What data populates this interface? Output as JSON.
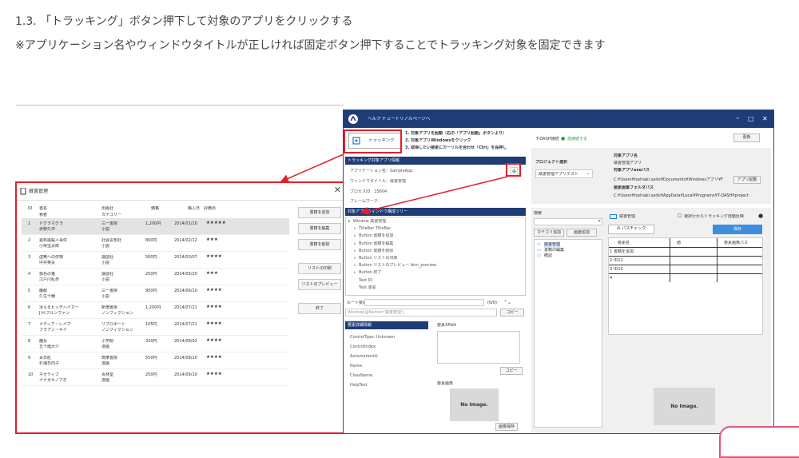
{
  "doc": {
    "heading": "1.3. 「トラッキング」ボタン押下して対象のアプリをクリックする",
    "note": "※アプリケーション名やウィンドウタイトルが正しければ固定ボタン押下することでトラッキング対象を固定できます"
  },
  "left_dialog": {
    "title": "蔵書管理",
    "columns": {
      "id": "ID",
      "title1": "書名",
      "title2": "著者",
      "pub1": "出版社",
      "pub2": "カテゴリー",
      "price": "価格",
      "date": "購入日",
      "rating": "評価点"
    },
    "rows": [
      {
        "id": "1",
        "title": "ドグラマグラ",
        "author": "夢野久作",
        "pub": "三一書房",
        "cat": "小説",
        "price": "1,200円",
        "date": "2014/01/10",
        "stars": "★★★★★"
      },
      {
        "id": "2",
        "title": "異邦風殺人事件",
        "author": "小栗虫太郎",
        "pub": "社会思想社",
        "cat": "小説",
        "price": "800円",
        "date": "2014/02/12",
        "stars": "★★★"
      },
      {
        "id": "3",
        "title": "虚無への供物",
        "author": "中井英夫",
        "pub": "講談社",
        "cat": "小説",
        "price": "500円",
        "date": "2014/03/07",
        "stars": "★★★★"
      },
      {
        "id": "4",
        "title": "孤島の鬼",
        "author": "江戸川乱歩",
        "pub": "講談社",
        "cat": "小説",
        "price": "250円",
        "date": "2014/05/20",
        "stars": "★★★"
      },
      {
        "id": "5",
        "title": "魔都",
        "author": "久生十蘭",
        "pub": "三一書房",
        "cat": "小説",
        "price": "950円",
        "date": "2014/06/10",
        "stars": "★★★★"
      },
      {
        "id": "6",
        "title": "冰えるヒッチハイカー",
        "author": "J.H.ブルンヴァン",
        "pub": "新宿書房",
        "cat": "ノンフィクション",
        "price": "1,200円",
        "date": "2014/07/21",
        "stars": "★★★★"
      },
      {
        "id": "7",
        "title": "メディア・レイプ",
        "author": "ブラアン・キイ",
        "pub": "リブロポート",
        "cat": "ノンフィクション",
        "price": "105円",
        "date": "2014/07/21",
        "stars": "★★★★"
      },
      {
        "id": "8",
        "title": "魔女",
        "author": "五十嵐大介",
        "pub": "小学館",
        "cat": "漫画",
        "price": "330円",
        "date": "2014/08/02",
        "stars": "★★★★"
      },
      {
        "id": "9",
        "title": "百日紅",
        "author": "杉浦日向子",
        "pub": "筑摩書房",
        "cat": "漫画",
        "price": "550円",
        "date": "2014/09/10",
        "stars": "★★★★"
      },
      {
        "id": "10",
        "title": "ネガティブ",
        "author": "イナガキノブオ",
        "pub": "青林堂",
        "cat": "漫画",
        "price": "250円",
        "date": "2014/09/10",
        "stars": "★★★★"
      }
    ],
    "buttons": [
      "書籍を追加",
      "書籍を編集",
      "書籍を削除",
      "リストの印刷",
      "リストのプレビュー",
      "終了"
    ]
  },
  "app": {
    "menu": [
      "ヘルプ",
      "チュートリアルページへ"
    ],
    "tracking_label": "トラッキング",
    "steps": [
      "1. 対象アプリを起動（右の「アプリ起動」ボタンより）",
      "2. 対象アプリWindowsをクリック",
      "3. 取得したい要素にカーソルを合わせ「Ctrl」を長押し"
    ],
    "tdash_label": "T-DASH接続",
    "retry": "再接続する",
    "update": "更新",
    "project_label": "プロジェクト選択",
    "project_value": "蔵書管理アプリテスト",
    "target_heading": "対象アプリ名",
    "target_name": "蔵書管理アプリ",
    "exe_heading": "対象アプリexeパス",
    "exe_path": "C:¥Users¥toshiaki.saito¥Documents¥Windowsアプリ¥F",
    "launch": "アプリ起動",
    "img_heading": "要素画像フォルダパス",
    "img_path": "C:¥Users¥toshiaki.saito¥AppData¥Local¥Programs¥T-DASH¥project",
    "info_title": "トラッキング対象アプリ情報",
    "app_name": "アプリケーション名：SampleApp",
    "window_title": "ウィンドウタイトル：蔵書管理",
    "pid": "プロセスID：25604",
    "framework": "フレームワーク：",
    "tree_title": "対象アプリウィンドウ構成ツリー",
    "tree": [
      "Window 蔵書管理",
      "TitleBar TitleBar",
      "Button 書籍を追加",
      "Button 書籍を編集",
      "Button 書籍を削除",
      "Button リストの印刷",
      "Button リストのプレビュー btm_preview",
      "Button 終了",
      "Text ID",
      "Text 書名"
    ],
    "route_label": "ルート要素",
    "route_count": "(0/0)",
    "route_value": "Window(@Name='蔵書管理')",
    "copy": "コピー",
    "detail_title": "要素詳細情報",
    "fields": [
      "ControlType:  Unknown",
      "ControlIndex:",
      "AutomationId:",
      "Name:",
      "ClassName:",
      "HelpText:"
    ],
    "xpath_label": "要素XPath",
    "element_img_label": "要素画像",
    "noimage": "No Image.",
    "save_img": "画像保存",
    "search_label": "検索",
    "cat_add": "カテゴリ追加",
    "screen_add": "画面追加",
    "cat_tree": [
      "蔵書管理",
      "書籍の編集",
      "確認"
    ],
    "screen_name": "蔵書管理",
    "auto_reflect": "選択行からトラッキング自動反映",
    "pathcheck": "パスチェック",
    "save": "保存",
    "table_cols": [
      "要素名",
      "値",
      "要素画像パス"
    ],
    "table_rows": [
      "書籍を追加",
      "ID11",
      "ID10",
      ""
    ]
  }
}
